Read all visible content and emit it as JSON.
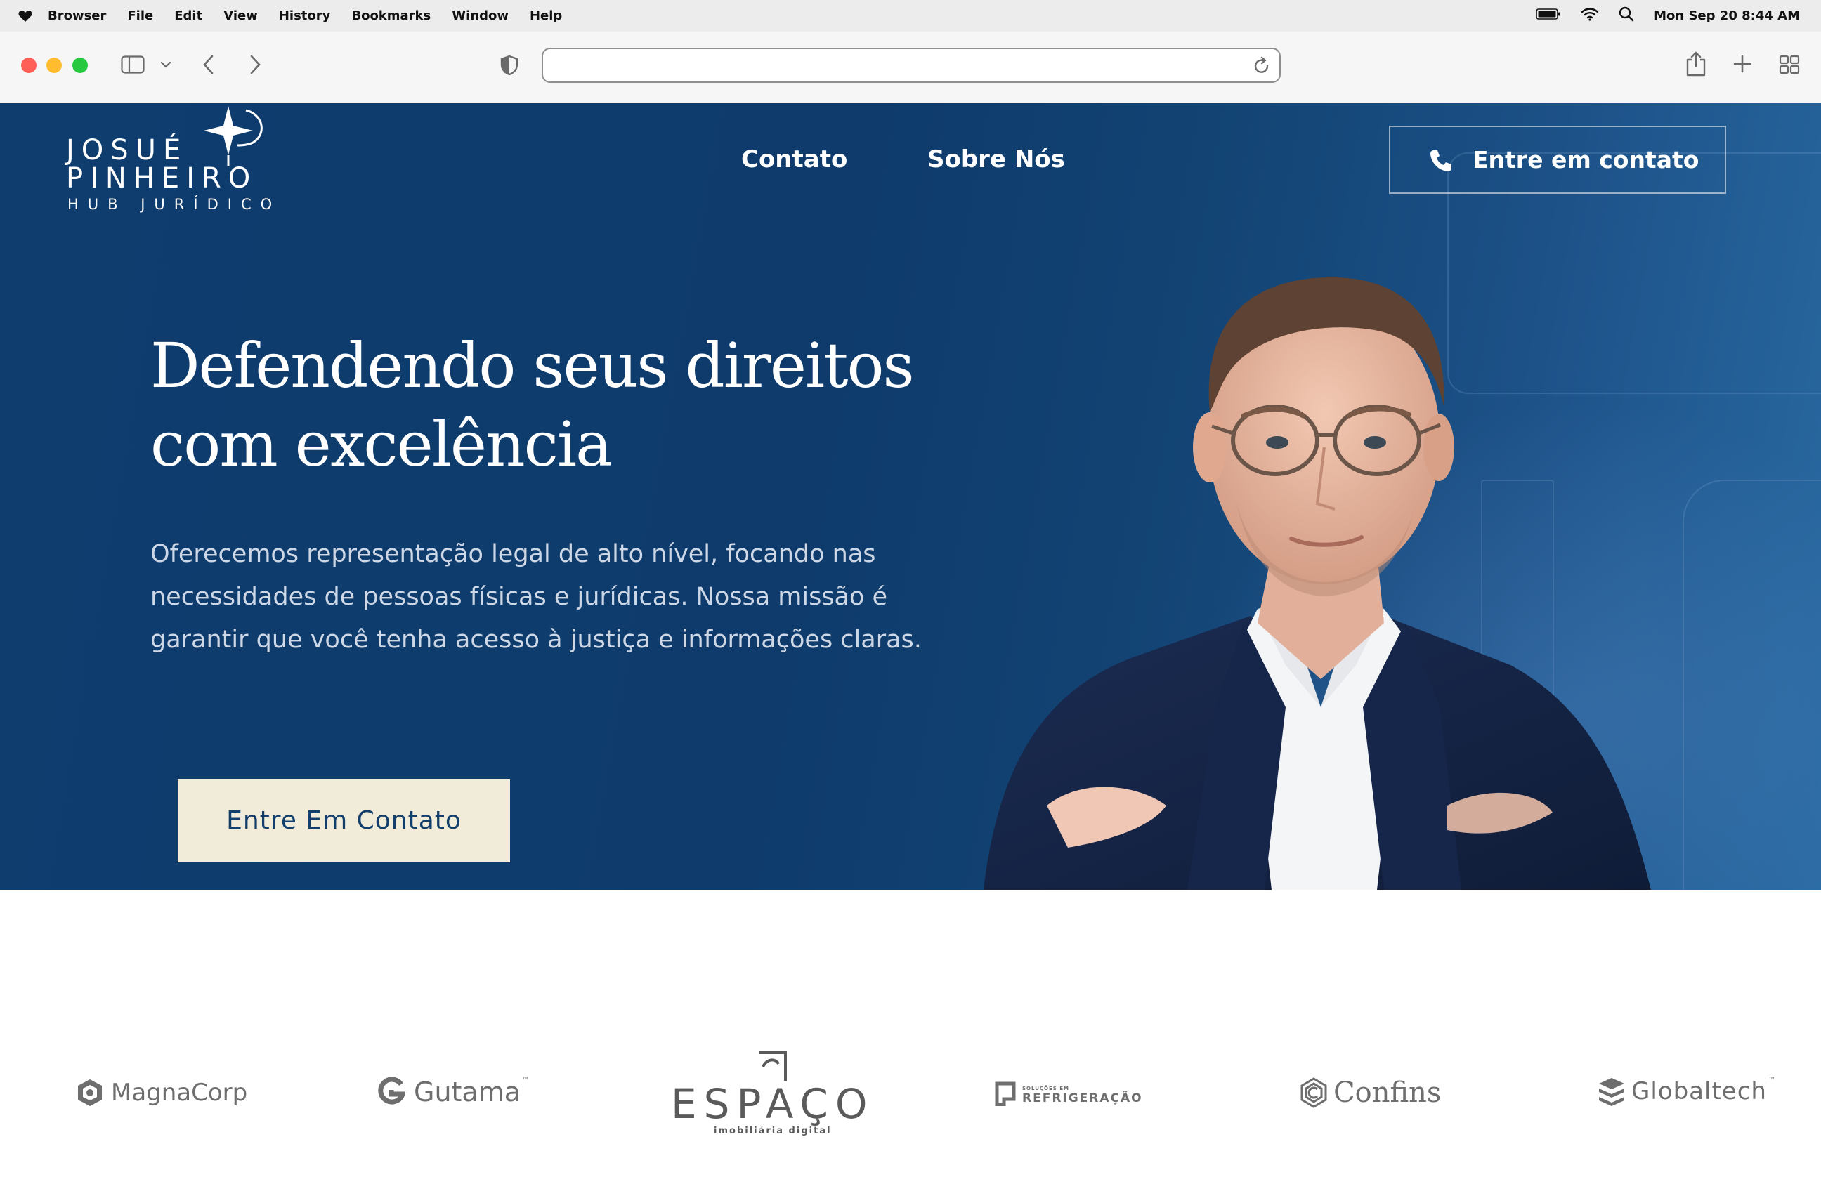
{
  "menubar": {
    "app_name": "Browser",
    "menus": [
      "File",
      "Edit",
      "View",
      "History",
      "Bookmarks",
      "Window",
      "Help"
    ],
    "clock": "Mon Sep 20  8:44 AM"
  },
  "browser": {
    "url": "",
    "traffic_lights": {
      "close": "#ff5f57",
      "minimize": "#febc2e",
      "maximize": "#28c840"
    }
  },
  "site": {
    "logo": {
      "line1": "JOSUÉ",
      "line2": "PINHEIRO",
      "line3": "HUB JURÍDICO"
    },
    "nav": {
      "contact": "Contato",
      "about": "Sobre Nós"
    },
    "header_cta": "Entre em contato",
    "hero": {
      "headline_line1": "Defendendo seus direitos",
      "headline_line2": "com excelência",
      "description": "Oferecemos representação legal de alto nível, focando nas necessidades de pessoas físicas e jurídicas. Nossa missão é garantir que você tenha acesso à justiça e informações claras.",
      "cta": "Entre Em Contato"
    },
    "clients": {
      "magnacorp": "MagnaCorp",
      "gutama": "Gutama",
      "gutama_tm": "™",
      "espaco": "ESPAÇO",
      "espaco_sub": "imobiliária digital",
      "refrig_small": "SOLUÇÕES EM",
      "refrig": "REFRIGERAÇÃO",
      "confins": "Confins",
      "globaltech": "Globaltech",
      "globaltech_tm": "™"
    },
    "colors": {
      "hero_bg": "#0f3d6e",
      "cta_bg": "#f1ecd9",
      "cta_text": "#123e6c",
      "logo_gray": "#6e6e6e"
    }
  }
}
